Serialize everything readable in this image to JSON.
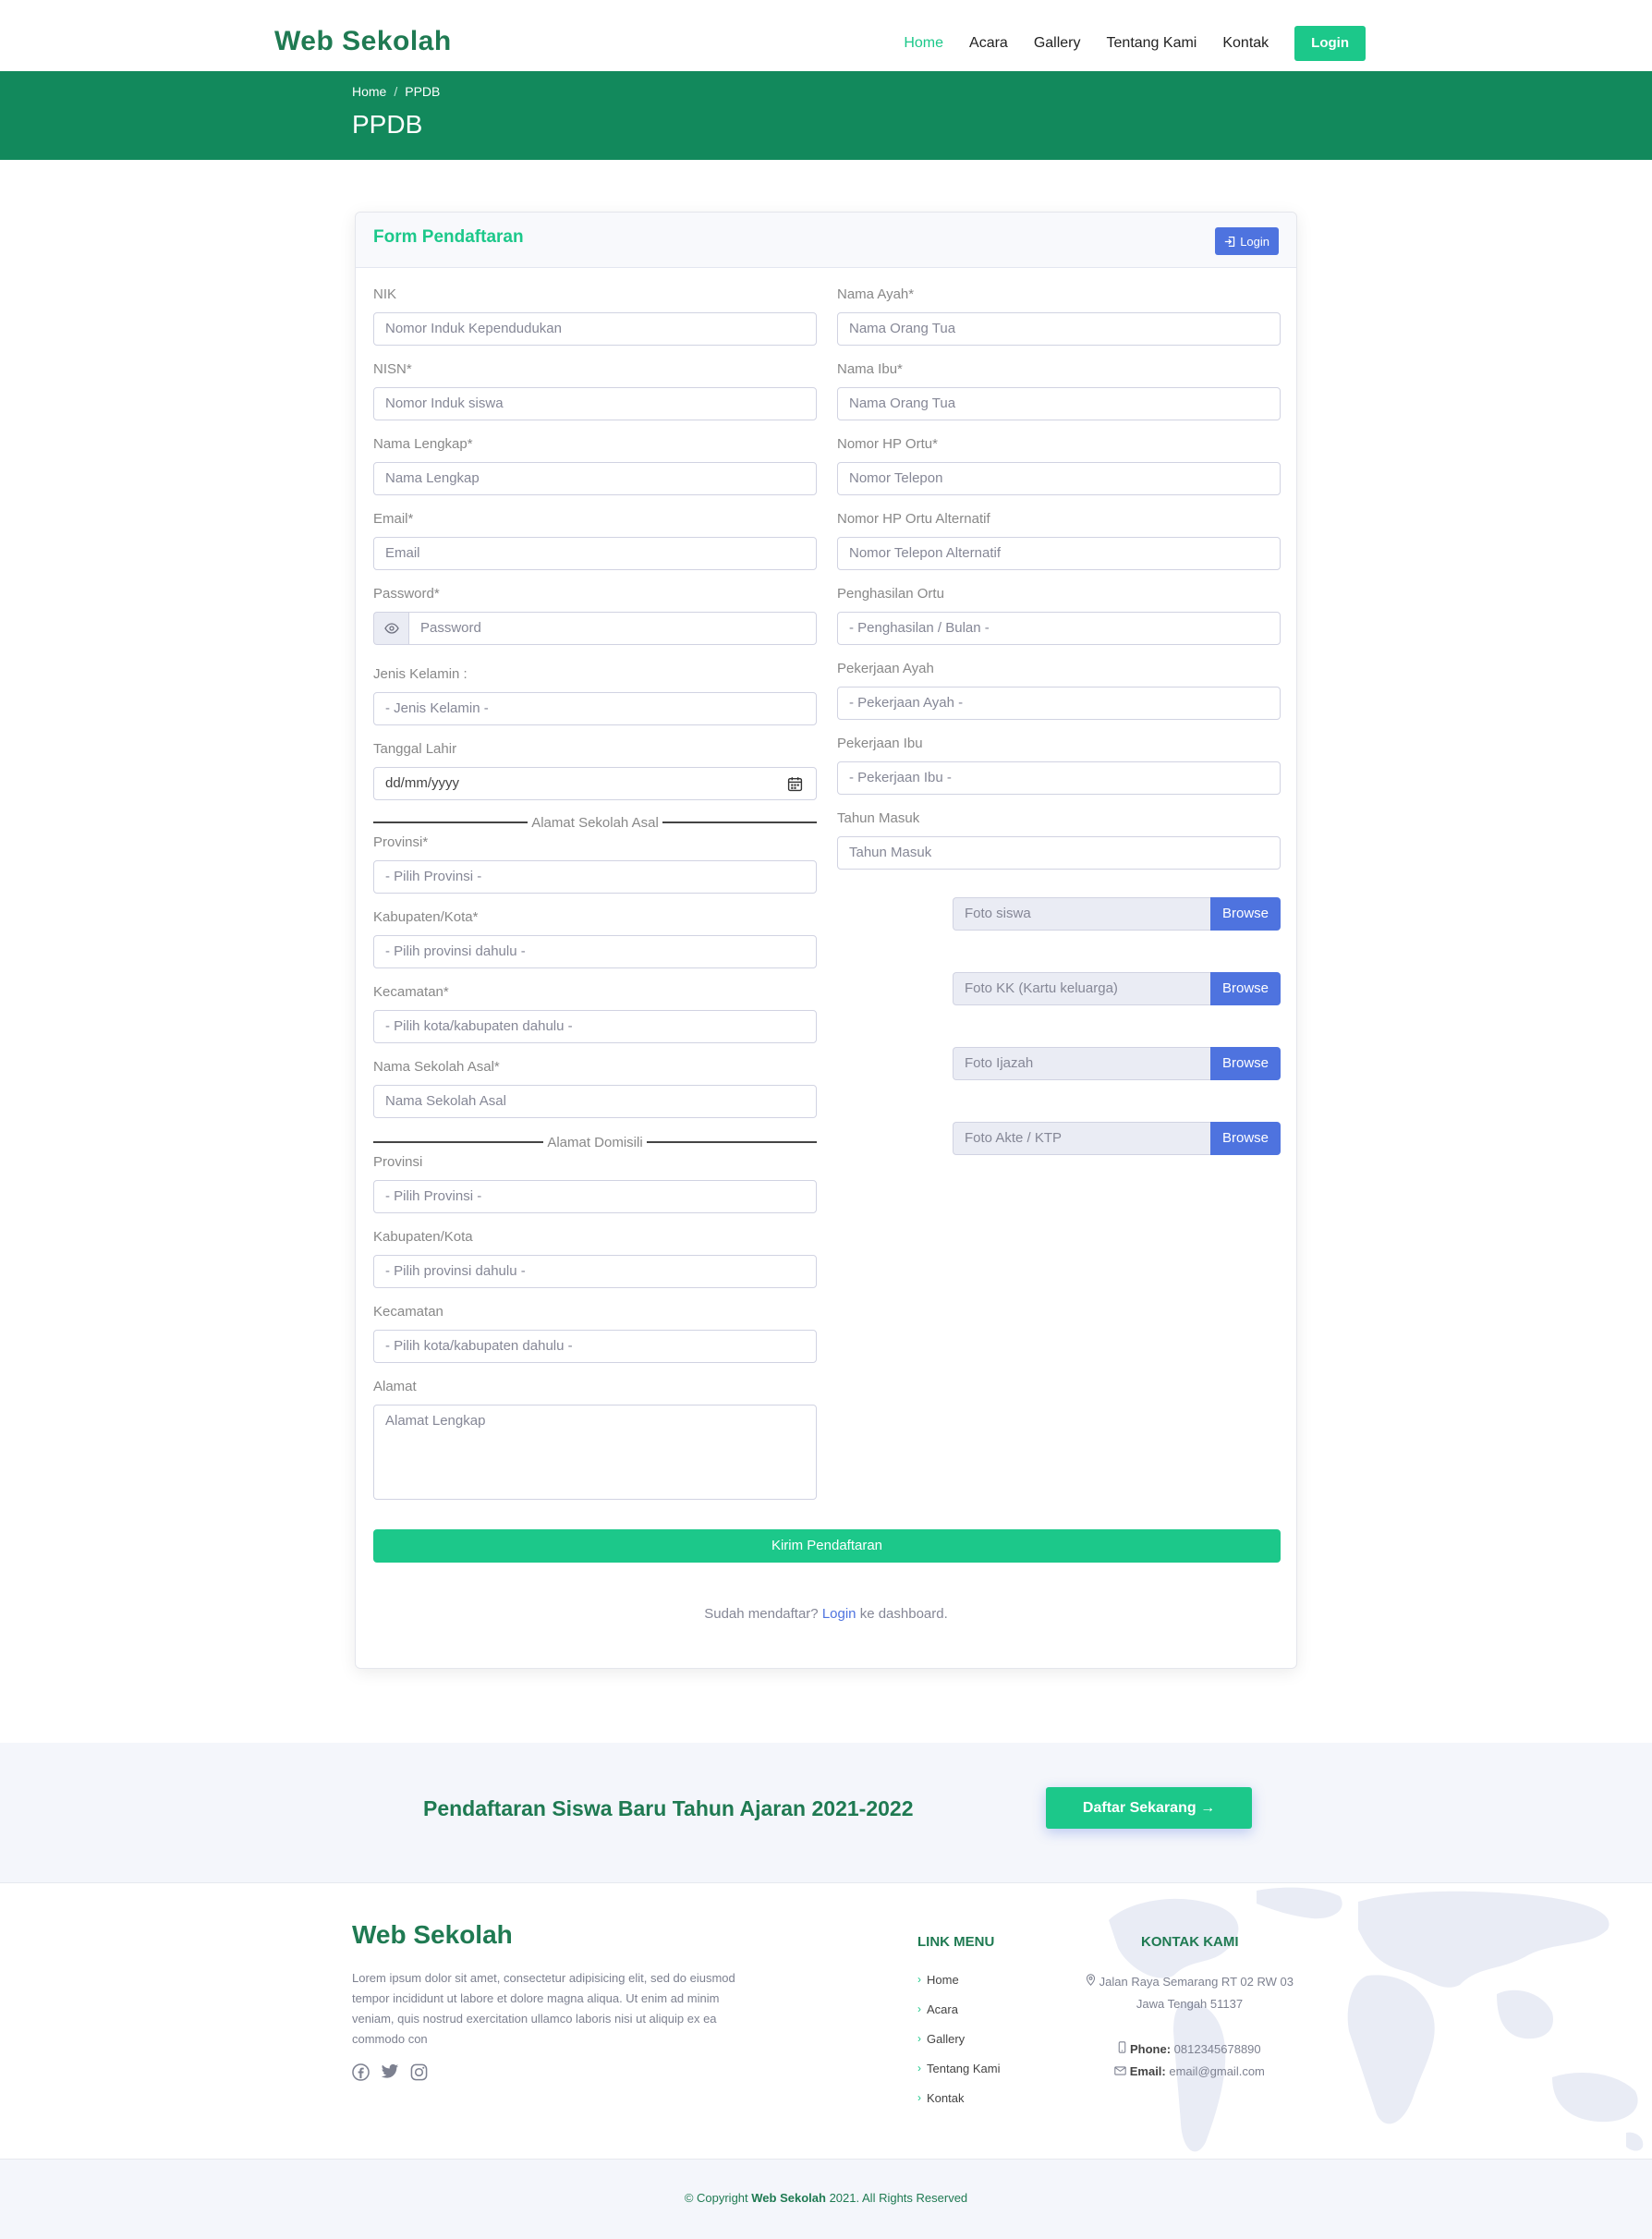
{
  "header": {
    "brand": "Web Sekolah",
    "nav": [
      "Home",
      "Acara",
      "Gallery",
      "Tentang Kami",
      "Kontak"
    ],
    "login": "Login"
  },
  "banner": {
    "crumb_home": "Home",
    "crumb_sep": "/",
    "crumb_current": "PPDB",
    "title": "PPDB"
  },
  "form": {
    "title": "Form Pendaftaran",
    "login_button": "Login",
    "left": {
      "nik_label": "NIK",
      "nik_ph": "Nomor Induk Kependudukan",
      "nisn_label": "NISN*",
      "nisn_ph": "Nomor Induk siswa",
      "nama_label": "Nama Lengkap*",
      "nama_ph": "Nama Lengkap",
      "email_label": "Email*",
      "email_ph": "Email",
      "password_label": "Password*",
      "password_ph": "Password",
      "jk_label": "Jenis Kelamin :",
      "jk_value": "- Jenis Kelamin -",
      "tgl_label": "Tanggal Lahir",
      "tgl_ph": "dd/mm/yyyy",
      "section_sekolah": "Alamat Sekolah Asal",
      "prov_label": "Provinsi*",
      "prov_value": "- Pilih Provinsi -",
      "kab_label": "Kabupaten/Kota*",
      "kab_value": "- Pilih provinsi dahulu -",
      "kec_label": "Kecamatan*",
      "kec_value": "- Pilih kota/kabupaten dahulu -",
      "sekolah_label": "Nama Sekolah Asal*",
      "sekolah_ph": "Nama Sekolah Asal",
      "section_domisili": "Alamat Domisili",
      "prov2_label": "Provinsi",
      "prov2_value": "- Pilih Provinsi -",
      "kab2_label": "Kabupaten/Kota",
      "kab2_value": "- Pilih provinsi dahulu -",
      "kec2_label": "Kecamatan",
      "kec2_value": "- Pilih kota/kabupaten dahulu -",
      "alamat_label": "Alamat",
      "alamat_ph": "Alamat Lengkap"
    },
    "right": {
      "ayah_label": "Nama Ayah*",
      "ayah_ph": "Nama Orang Tua",
      "ibu_label": "Nama Ibu*",
      "ibu_ph": "Nama Orang Tua",
      "hp_label": "Nomor HP Ortu*",
      "hp_ph": "Nomor Telepon",
      "hp2_label": "Nomor HP Ortu Alternatif",
      "hp2_ph": "Nomor Telepon Alternatif",
      "penghasilan_label": "Penghasilan Ortu",
      "penghasilan_value": "- Penghasilan / Bulan -",
      "pkj_ayah_label": "Pekerjaan Ayah",
      "pkj_ayah_value": "- Pekerjaan Ayah -",
      "pkj_ibu_label": "Pekerjaan Ibu",
      "pkj_ibu_value": "- Pekerjaan Ibu -",
      "tahun_label": "Tahun Masuk",
      "tahun_ph": "Tahun Masuk"
    },
    "files": [
      {
        "name": "Foto siswa",
        "button": "Browse"
      },
      {
        "name": "Foto KK (Kartu keluarga)",
        "button": "Browse"
      },
      {
        "name": "Foto Ijazah",
        "button": "Browse"
      },
      {
        "name": "Foto Akte / KTP",
        "button": "Browse"
      }
    ],
    "submit": "Kirim Pendaftaran",
    "already_pre": "Sudah mendaftar?",
    "already_link": "Login",
    "already_post": "ke dashboard."
  },
  "cta": {
    "text": "Pendaftaran Siswa Baru Tahun Ajaran 2021-2022",
    "button": "Daftar Sekarang →"
  },
  "footer": {
    "brand": "Web Sekolah",
    "desc": "Lorem ipsum dolor sit amet, consectetur adipisicing elit, sed do eiusmod tempor incididunt ut labore et dolore magna aliqua. Ut enim ad minim veniam, quis nostrud exercitation ullamco laboris nisi ut aliquip ex ea commodo con",
    "menu_title": "LINK MENU",
    "menu": [
      "Home",
      "Acara",
      "Gallery",
      "Tentang Kami",
      "Kontak"
    ],
    "contact_title": "KONTAK KAMI",
    "address1": "Jalan Raya Semarang RT 02 RW 03",
    "address2": "Jawa Tengah 51137",
    "phone_label": "Phone:",
    "phone": "0812345678890",
    "email_label": "Email:",
    "email": "email@gmail.com",
    "copy_pre": "© Copyright",
    "copy_brand": "Web Sekolah",
    "copy_post": "2021. All Rights Reserved"
  },
  "colors": {
    "brand_green": "#1f7a52",
    "banner_green": "#12895c",
    "accent_green": "#1cc88a",
    "primary_blue": "#4e73df"
  },
  "icons": [
    "eye-icon",
    "calendar-icon",
    "sign-in-icon",
    "facebook-icon",
    "twitter-icon",
    "instagram-icon",
    "map-pin-icon",
    "phone-icon",
    "envelope-icon"
  ]
}
